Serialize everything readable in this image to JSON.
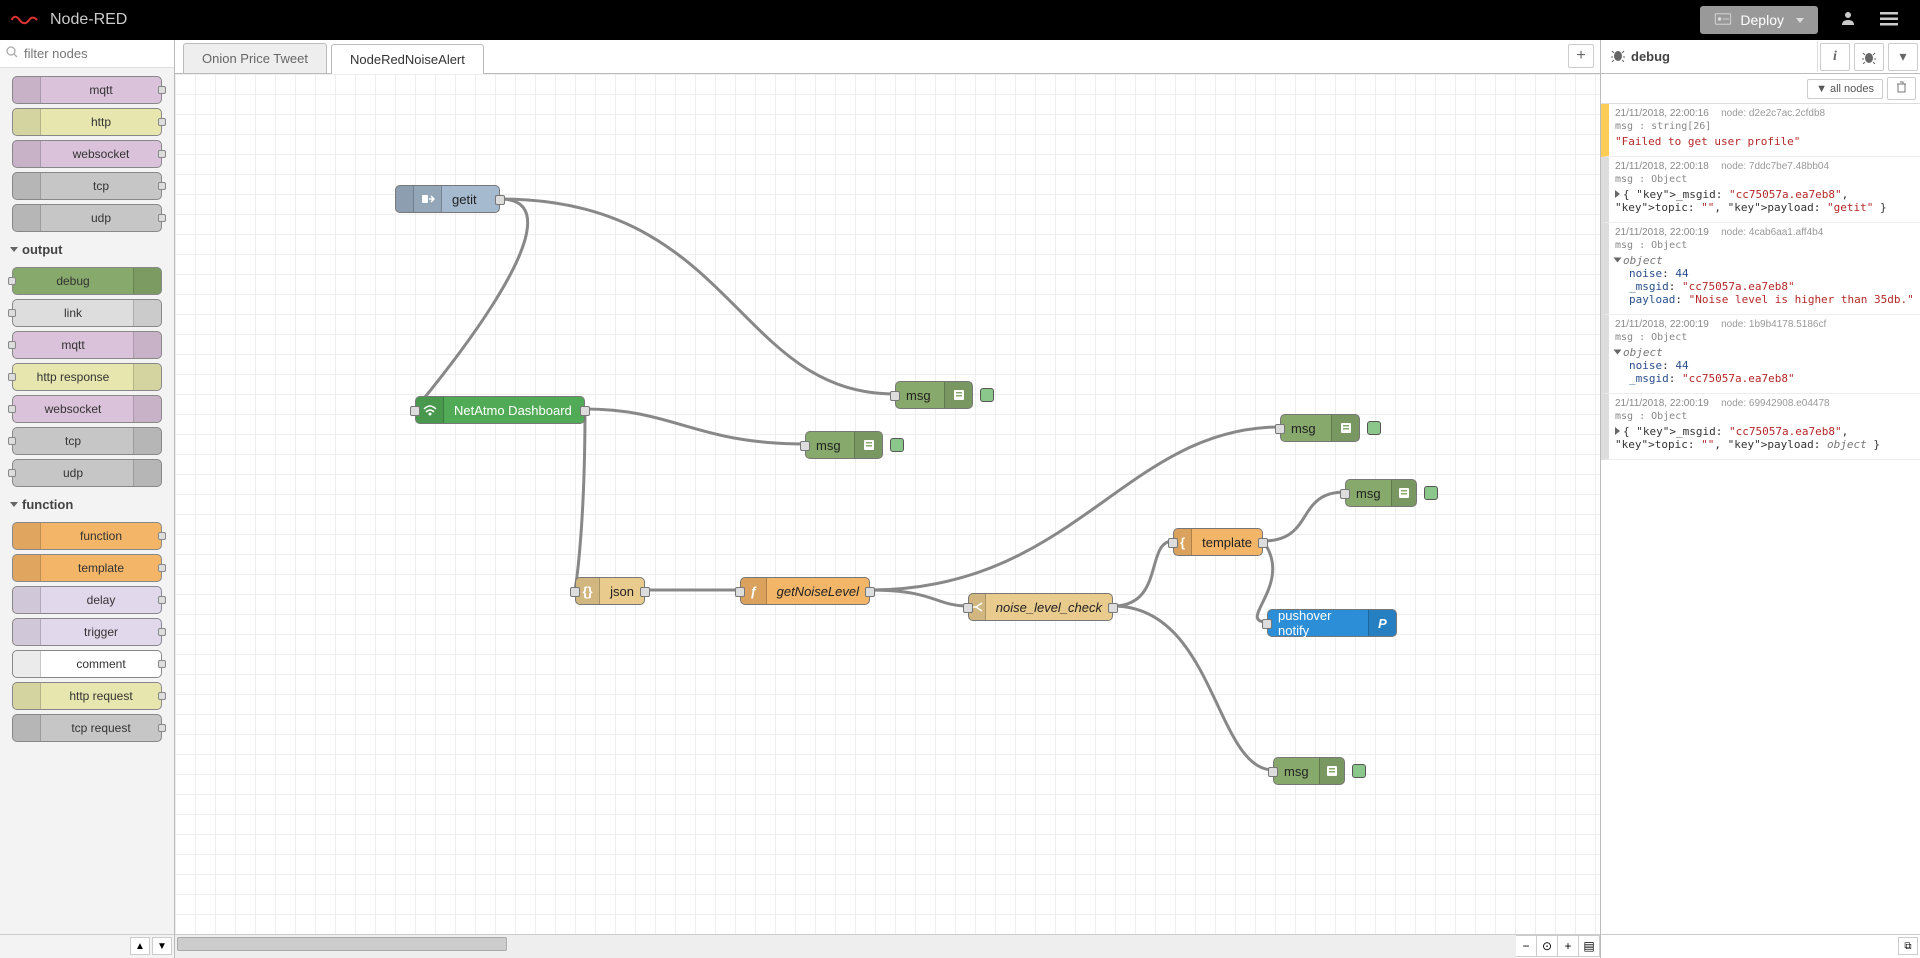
{
  "header": {
    "title": "Node-RED",
    "deploy": "Deploy"
  },
  "palette": {
    "filter_placeholder": "filter nodes",
    "cat_output": "output",
    "cat_function": "function",
    "nodes_upper": [
      {
        "label": "mqtt",
        "bg": "#d9c2da"
      },
      {
        "label": "http",
        "bg": "#e7e6af"
      },
      {
        "label": "websocket",
        "bg": "#d9c2da"
      },
      {
        "label": "tcp",
        "bg": "#c6c6c6"
      },
      {
        "label": "udp",
        "bg": "#c6c6c6"
      }
    ],
    "nodes_output": [
      {
        "label": "debug",
        "bg": "#87a96b"
      },
      {
        "label": "link",
        "bg": "#dddddd"
      },
      {
        "label": "mqtt",
        "bg": "#d9c2da"
      },
      {
        "label": "http response",
        "bg": "#e7e6af"
      },
      {
        "label": "websocket",
        "bg": "#d9c2da"
      },
      {
        "label": "tcp",
        "bg": "#c6c6c6"
      },
      {
        "label": "udp",
        "bg": "#c6c6c6"
      }
    ],
    "nodes_function": [
      {
        "label": "function",
        "bg": "#f3b568"
      },
      {
        "label": "template",
        "bg": "#f3b568"
      },
      {
        "label": "delay",
        "bg": "#e2d8eb"
      },
      {
        "label": "trigger",
        "bg": "#e2d8eb"
      },
      {
        "label": "comment",
        "bg": "#ffffff"
      },
      {
        "label": "http request",
        "bg": "#e7e6af"
      },
      {
        "label": "tcp request",
        "bg": "#c6c6c6"
      }
    ]
  },
  "tabs": {
    "t1": "Onion Price Tweet",
    "t2": "NodeRedNoiseAlert"
  },
  "flow": {
    "getit": "getit",
    "netatmo": "NetAtmo Dashboard",
    "msg": "msg",
    "json": "json",
    "getnoise": "getNoiseLevel",
    "noisecheck": "noise_level_check",
    "template": "template",
    "pushover": "pushover notify"
  },
  "sidebar": {
    "title": "debug",
    "filter": "all nodes"
  },
  "debug": [
    {
      "color": "#fc5",
      "ts": "21/11/2018, 22:00:16",
      "node": "d2e2c7ac.2cfdb8",
      "topic": "msg : string[26]",
      "payload_str": "\"Failed to get user profile\""
    },
    {
      "color": "#ddd",
      "ts": "21/11/2018, 22:00:18",
      "node": "7ddc7be7.48bb04",
      "topic": "msg : Object",
      "collapsed": true,
      "line": "{ _msgid: \"cc75057a.ea7eb8\", topic: \"\", payload: \"getit\" }"
    },
    {
      "color": "#ddd",
      "ts": "21/11/2018, 22:00:19",
      "node": "4cab6aa1.aff4b4",
      "topic": "msg : Object",
      "expanded": true,
      "obj": {
        "noise": "44",
        "_msgid": "\"cc75057a.ea7eb8\"",
        "payload": "\"Noise level is higher than 35db.\""
      }
    },
    {
      "color": "#ddd",
      "ts": "21/11/2018, 22:00:19",
      "node": "1b9b4178.5186cf",
      "topic": "msg : Object",
      "expanded": true,
      "obj": {
        "noise": "44",
        "_msgid": "\"cc75057a.ea7eb8\""
      }
    },
    {
      "color": "#ddd",
      "ts": "21/11/2018, 22:00:19",
      "node": "69942908.e04478",
      "topic": "msg : Object",
      "collapsed": true,
      "line": "{ _msgid: \"cc75057a.ea7eb8\", topic: \"\", payload: object }"
    }
  ]
}
